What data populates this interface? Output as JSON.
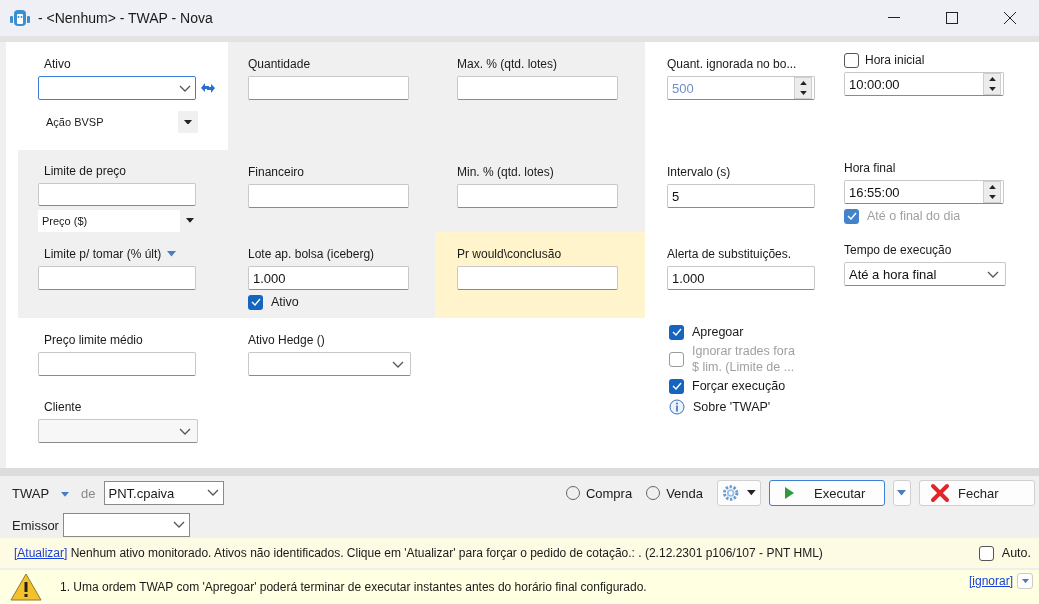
{
  "window": {
    "title": "- <Nenhum> - TWAP - Nova"
  },
  "form": {
    "rows": [
      [
        {
          "label": "Ativo",
          "kind": "asset",
          "focused": true,
          "color": "#ffffff",
          "sub_select": "Ação BVSP"
        },
        {
          "label": "Quantidade",
          "kind": "text",
          "color": "#f0f0f0"
        },
        {
          "label": "Max. % (qtd. lotes)",
          "kind": "text",
          "color": "#f0f0f0"
        },
        {
          "label": "Quant. ignorada no bo...",
          "kind": "spin",
          "value": "500",
          "dimmed": true,
          "color": "#ffffff"
        },
        {
          "label": "Hora inicial",
          "kind": "spin",
          "value": "10:00:00",
          "label_check": {
            "checked": false
          },
          "color": "#ffffff"
        }
      ],
      [
        {
          "label": "Limite de preço",
          "kind": "text",
          "color": "#f0f0f0",
          "sub_select": "Preço ($)"
        },
        {
          "label": "Financeiro",
          "kind": "text",
          "color": "#f0f0f0"
        },
        {
          "label": "Min. % (qtd. lotes)",
          "kind": "text",
          "color": "#f0f0f0"
        },
        {
          "label": "Intervalo (s)",
          "kind": "text",
          "value": "5",
          "color": "#ffffff"
        },
        {
          "label": "Hora final",
          "kind": "spin",
          "value": "16:55:00",
          "color": "#ffffff",
          "check": {
            "label": "Até o final do dia",
            "checked": true,
            "disabled": true
          }
        }
      ],
      [
        {
          "label": "Limite p/ tomar (% últ)",
          "kind": "text",
          "label_menu": true,
          "color": "#f0f0f0"
        },
        {
          "label": "Lote ap. bolsa (iceberg)",
          "kind": "text",
          "value": "1.000",
          "color": "#f0f0f0",
          "check": {
            "label": "Ativo",
            "checked": true,
            "disabled": false
          }
        },
        {
          "label": "Pr would\\conclusão",
          "kind": "text",
          "color": "#fff4cc"
        },
        {
          "label": "Alerta de substituições.",
          "kind": "text",
          "value": "1.000",
          "color": "#ffffff"
        },
        {
          "label": "Tempo de execução",
          "kind": "combo",
          "value": "Até a hora final",
          "color": "#ffffff"
        }
      ],
      [
        {
          "label": "Preço limite médio",
          "kind": "text",
          "color": "#ffffff"
        },
        {
          "label": "Ativo Hedge ()",
          "kind": "combo",
          "color": "#ffffff"
        }
      ],
      [
        {
          "label": "Cliente",
          "kind": "combo",
          "disabled": true,
          "color": "#ffffff"
        }
      ]
    ],
    "options": [
      {
        "kind": "check",
        "label": "Apregoar",
        "checked": true,
        "disabled": false
      },
      {
        "kind": "check",
        "label": "Ignorar trades fora $ lim. (Limite de ...",
        "checked": false,
        "disabled": true
      },
      {
        "kind": "check",
        "label": "Forçar execução",
        "checked": true,
        "disabled": false
      },
      {
        "kind": "info",
        "label": "Sobre 'TWAP'"
      }
    ]
  },
  "toolbar": {
    "order_type": "TWAP",
    "de_label": "de",
    "user": "PNT.cpaiva",
    "sides": [
      {
        "label": "Compra",
        "selected": false
      },
      {
        "label": "Venda",
        "selected": false
      }
    ],
    "execute": "Executar",
    "close": "Fechar",
    "issuer_label": "Emissor"
  },
  "status": {
    "link": "[Atualizar]",
    "message": "Nenhum ativo monitorado. Ativos não identificados. Clique em 'Atualizar' para forçar o pedido de cotação.: .",
    "version": "(2.12.2301 p106/107 - PNT HML)",
    "auto": {
      "label": "Auto.",
      "checked": false
    }
  },
  "warning": {
    "message": "1. Uma ordem TWAP com 'Apregoar' poderá terminar de executar instantes antes do horário final configurado.",
    "link": "[ignorar]"
  }
}
